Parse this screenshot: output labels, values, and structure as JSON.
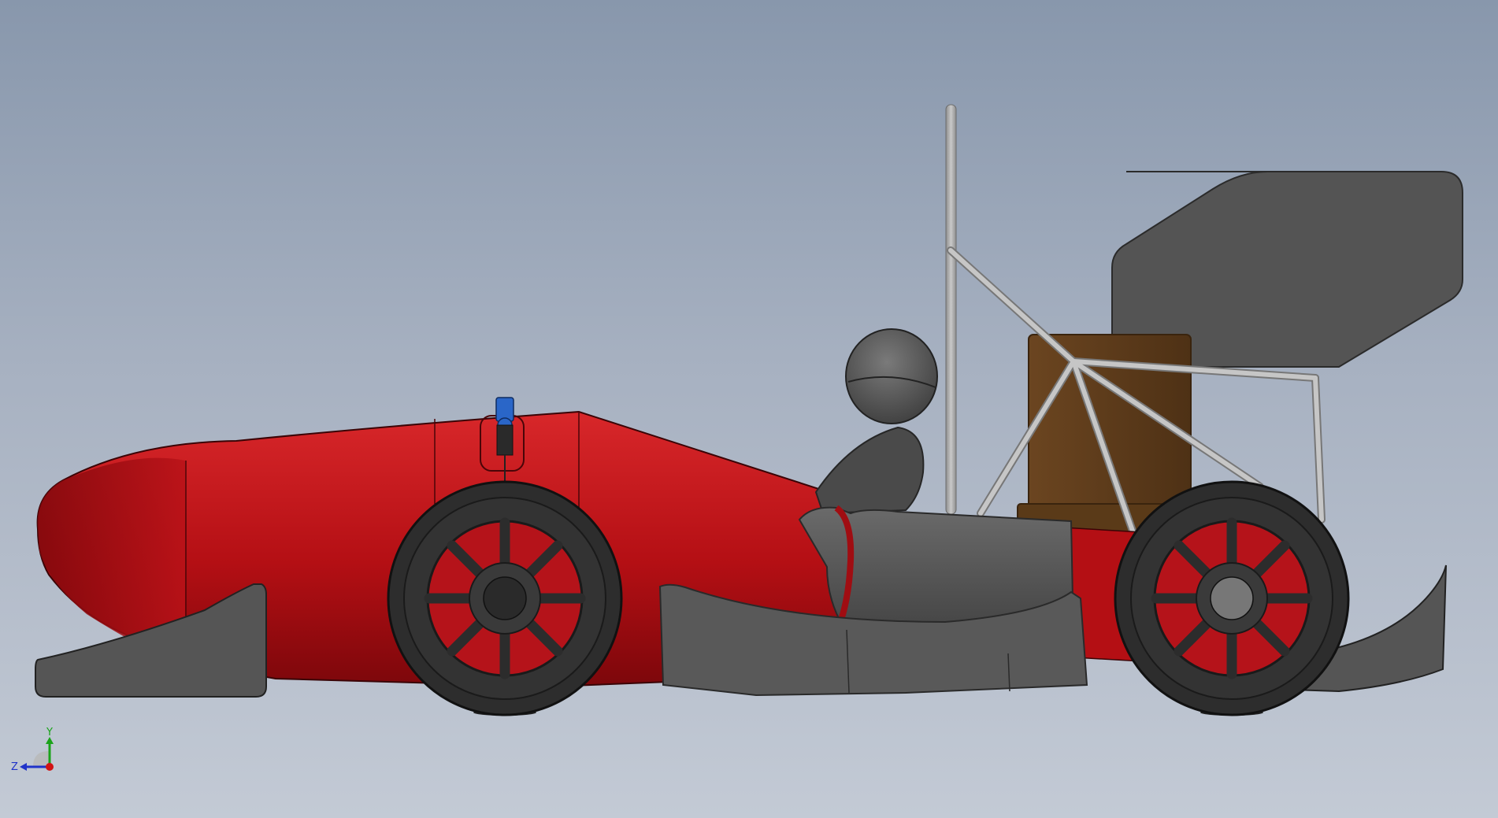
{
  "view": {
    "background_top": "#8897ac",
    "background_bottom": "#c3cad5",
    "model_colors": {
      "body": "#c4161c",
      "body_dark": "#8a0a0e",
      "tire": "#2b2b2b",
      "aero": "#555555",
      "frame_tube": "#a9a9a9",
      "seat": "#5b3a1a",
      "camera": "#2a66c8"
    }
  },
  "triad": {
    "y_label": "Y",
    "z_label": "Z",
    "y_color": "#1aa31a",
    "z_color": "#2033c9",
    "x_color": "#d21414"
  }
}
